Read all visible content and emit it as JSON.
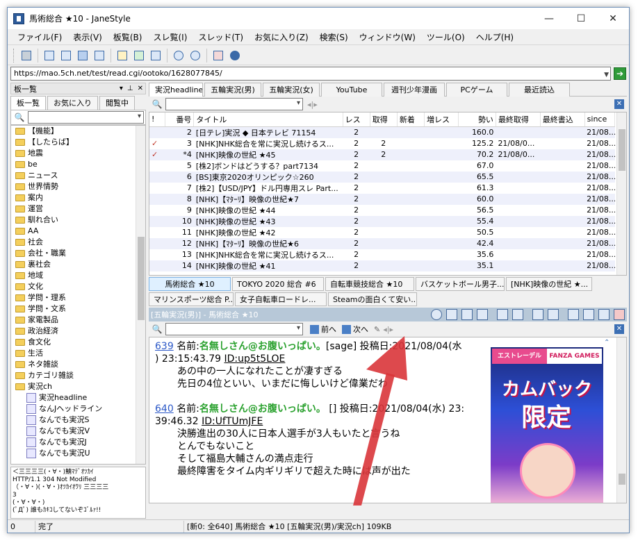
{
  "window": {
    "title": "馬術総合 ★10 - JaneStyle",
    "controls": {
      "minimize": "—",
      "maximize": "☐",
      "close": "✕"
    }
  },
  "menu": [
    "ファイル(F)",
    "表示(V)",
    "板覧(B)",
    "スレ覧(I)",
    "スレッド(T)",
    "お気に入り(Z)",
    "検索(S)",
    "ウィンドウ(W)",
    "ツール(O)",
    "ヘルプ(H)"
  ],
  "address": {
    "url": "https://mao.5ch.net/test/read.cgi/ootoko/1628077845/",
    "go_icon": "➔"
  },
  "left_pane": {
    "header": "板一覧",
    "header_buttons": [
      "▾",
      "⊥",
      "✕"
    ],
    "tabs": [
      "板一覧",
      "お気に入り",
      "閲覧中"
    ],
    "search_icon": "🔍",
    "categories": [
      "【機能】",
      "【したらば】",
      "地震",
      "be",
      "ニュース",
      "世界情勢",
      "案内",
      "運営",
      "馴れ合い",
      "AA",
      "社会",
      "会社・職業",
      "裏社会",
      "地域",
      "文化",
      "学問・理系",
      "学問・文系",
      "家電製品",
      "政治経済",
      "食文化",
      "生活",
      "ネタ雑談",
      "カテゴリ雑談",
      "実況ch"
    ],
    "boards": [
      "実況headline",
      "なんJヘッドライン",
      "なんでも実況S",
      "なんでも実況V",
      "なんでも実況J",
      "なんでも実況U"
    ],
    "log": "＜三三三三(・∀・)鯖ﾏﾃﾞｵﾂｶｲ\nHTTP/1.1 304 Not Modified\n（・∀・)(・∀・)ｵﾂｶｲｵﾜﾘ 三三三三\n3\n(・∀・∀・)\n(ﾟДﾟ) 誰もｶｷｺしてないぞｺﾞﾙｧ!!"
  },
  "board_tabs": [
    "実況headline",
    "五輪実況(男)",
    "五輪実況(女)",
    "YouTube",
    "週刊少年漫画",
    "PCゲーム",
    "最近読込"
  ],
  "thread_list": {
    "columns": [
      "!",
      "番号",
      "タイトル",
      "レス",
      "取得",
      "新着",
      "増レス",
      "勢い",
      "最終取得",
      "最終書込",
      "since"
    ],
    "rows": [
      {
        "mark": "",
        "no": "2",
        "title": "[日テレ]実況 ◆ 日本テレビ 71154",
        "res": "2",
        "got": "",
        "new": "",
        "inc": "",
        "ikioi": "160.0",
        "last_got": "",
        "last_post": "",
        "since": "21/08..."
      },
      {
        "mark": "✓",
        "no": "3",
        "title": "[NHK]NHK総合を常に実況し続けるス...",
        "res": "2",
        "got": "2",
        "new": "",
        "inc": "",
        "ikioi": "125.2",
        "last_got": "21/08/0...",
        "last_post": "",
        "since": "21/08..."
      },
      {
        "mark": "✓",
        "no": "*4",
        "title": "[NHK]映像の世紀 ★45",
        "res": "2",
        "got": "2",
        "new": "",
        "inc": "",
        "ikioi": "70.2",
        "last_got": "21/08/0...",
        "last_post": "",
        "since": "21/08..."
      },
      {
        "mark": "",
        "no": "5",
        "title": "[株2]ボンドはどうする？part7134",
        "res": "2",
        "got": "",
        "new": "",
        "inc": "",
        "ikioi": "67.0",
        "last_got": "",
        "last_post": "",
        "since": "21/08..."
      },
      {
        "mark": "",
        "no": "6",
        "title": "[BS]東京2020オリンピック☆260",
        "res": "2",
        "got": "",
        "new": "",
        "inc": "",
        "ikioi": "65.5",
        "last_got": "",
        "last_post": "",
        "since": "21/08..."
      },
      {
        "mark": "",
        "no": "7",
        "title": "[株2]【USD/JPY】ドル円専用スレ Part...",
        "res": "2",
        "got": "",
        "new": "",
        "inc": "",
        "ikioi": "61.3",
        "last_got": "",
        "last_post": "",
        "since": "21/08..."
      },
      {
        "mark": "",
        "no": "8",
        "title": "[NHK]【ﾏﾀｰﾘ】映像の世紀★7",
        "res": "2",
        "got": "",
        "new": "",
        "inc": "",
        "ikioi": "60.0",
        "last_got": "",
        "last_post": "",
        "since": "21/08..."
      },
      {
        "mark": "",
        "no": "9",
        "title": "[NHK]映像の世紀 ★44",
        "res": "2",
        "got": "",
        "new": "",
        "inc": "",
        "ikioi": "56.5",
        "last_got": "",
        "last_post": "",
        "since": "21/08..."
      },
      {
        "mark": "",
        "no": "10",
        "title": "[NHK]映像の世紀 ★43",
        "res": "2",
        "got": "",
        "new": "",
        "inc": "",
        "ikioi": "55.4",
        "last_got": "",
        "last_post": "",
        "since": "21/08..."
      },
      {
        "mark": "",
        "no": "11",
        "title": "[NHK]映像の世紀 ★42",
        "res": "2",
        "got": "",
        "new": "",
        "inc": "",
        "ikioi": "50.5",
        "last_got": "",
        "last_post": "",
        "since": "21/08..."
      },
      {
        "mark": "",
        "no": "12",
        "title": "[NHK]【ﾏﾀｰﾘ】映像の世紀★6",
        "res": "2",
        "got": "",
        "new": "",
        "inc": "",
        "ikioi": "42.4",
        "last_got": "",
        "last_post": "",
        "since": "21/08..."
      },
      {
        "mark": "",
        "no": "13",
        "title": "[NHK]NHK総合を常に実況し続けるス...",
        "res": "2",
        "got": "",
        "new": "",
        "inc": "",
        "ikioi": "35.6",
        "last_got": "",
        "last_post": "",
        "since": "21/08..."
      },
      {
        "mark": "",
        "no": "14",
        "title": "[NHK]映像の世紀 ★41",
        "res": "2",
        "got": "",
        "new": "",
        "inc": "",
        "ikioi": "35.1",
        "last_got": "",
        "last_post": "",
        "since": "21/08..."
      }
    ]
  },
  "thread_tabs": {
    "row1": [
      "馬術総合 ★10",
      "TOKYO 2020 総合 #6",
      "自転車競技総合 ★10",
      "バスケットボール男子...",
      "[NHK]映像の世紀 ★..."
    ],
    "row2": [
      "マリンスポーツ総合 P...",
      "女子自転車ロードレ...",
      "Steamの面白くて安い..."
    ]
  },
  "thread_header": "[五輪実況(男)] - 馬術総合 ★10",
  "nav": {
    "prev": "前へ",
    "next": "次へ"
  },
  "posts": [
    {
      "num": "639",
      "name_label": "名前:",
      "name": "名無しさん@お腹いっぱい。",
      "mail": "[sage]",
      "date_label": "投稿日:",
      "date": "2021/08/04(水",
      "line2": ") 23:15:43.79 ",
      "id": "ID:up5t5LOE",
      "body": [
        "あの中の一人になれたことが凄すぎる",
        "先日の4位といい、いまだに悔しいけど偉業だわ"
      ]
    },
    {
      "num": "640",
      "name_label": "名前:",
      "name": "名無しさん@お腹いっぱい。",
      "mail": "[]",
      "date_label": "投稿日:",
      "date": "2021/08/04(水) 23:",
      "line2": "39:46.32 ",
      "id": "ID:UfTUmJFE",
      "body": [
        "決勝進出の30人に日本人選手が3人もいたと言うね",
        "とんでもないこと",
        "そして福島大輔さんの満点走行",
        "最終障害をタイム内ギリギリで超えた時には声が出た"
      ]
    }
  ],
  "ad": {
    "brand1": "エストレーデル",
    "brand2": "FANZA GAMES",
    "line1": "カムバック",
    "line2": "限定"
  },
  "status": {
    "count": "0",
    "state": "完了",
    "info": "[新0: 全640] 馬術総合 ★10 [五輪実況(男)/実況ch] 109KB"
  }
}
